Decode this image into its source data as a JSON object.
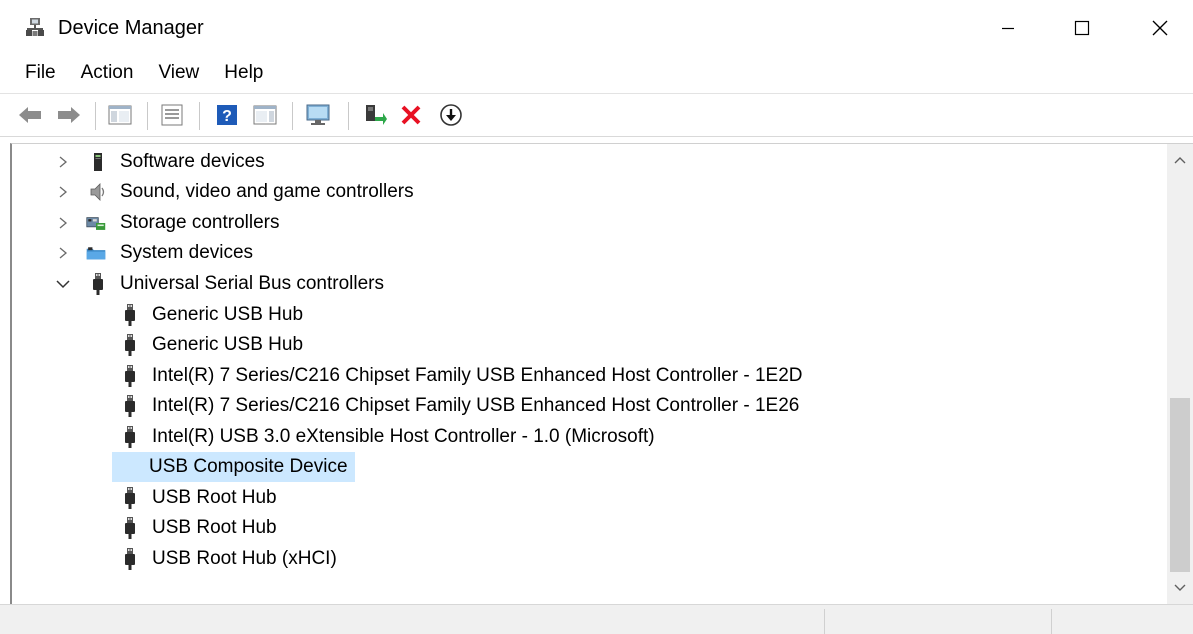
{
  "window": {
    "title": "Device Manager",
    "icon": "device-manager-icon"
  },
  "window_controls": {
    "minimize": "minimize-icon",
    "maximize": "maximize-icon",
    "close": "close-icon"
  },
  "menu": {
    "items": [
      {
        "label": "File"
      },
      {
        "label": "Action"
      },
      {
        "label": "View"
      },
      {
        "label": "Help"
      }
    ]
  },
  "toolbar": {
    "buttons": [
      {
        "icon": "back-arrow-icon"
      },
      {
        "icon": "forward-arrow-icon"
      },
      {
        "icon": "show-hide-console-tree-icon"
      },
      {
        "icon": "properties-icon"
      },
      {
        "icon": "help-icon"
      },
      {
        "icon": "show-hide-action-pane-icon"
      },
      {
        "icon": "scan-hardware-icon"
      },
      {
        "icon": "update-driver-icon"
      },
      {
        "icon": "uninstall-device-icon"
      },
      {
        "icon": "download-arrow-icon"
      }
    ]
  },
  "tree": {
    "categories": [
      {
        "label": "Software devices",
        "icon": "software-device-icon",
        "expanded": false
      },
      {
        "label": "Sound, video and game controllers",
        "icon": "speaker-icon",
        "expanded": false
      },
      {
        "label": "Storage controllers",
        "icon": "storage-controller-icon",
        "expanded": false
      },
      {
        "label": "System devices",
        "icon": "system-folder-icon",
        "expanded": false
      },
      {
        "label": "Universal Serial Bus controllers",
        "icon": "usb-plug-icon",
        "expanded": true
      }
    ],
    "usb_children": [
      {
        "label": "Generic USB Hub"
      },
      {
        "label": "Generic USB Hub"
      },
      {
        "label": "Intel(R) 7 Series/C216 Chipset Family USB Enhanced Host Controller - 1E2D"
      },
      {
        "label": "Intel(R) 7 Series/C216 Chipset Family USB Enhanced Host Controller - 1E26"
      },
      {
        "label": "Intel(R) USB 3.0 eXtensible Host Controller - 1.0 (Microsoft)"
      },
      {
        "label": "USB Composite Device",
        "selected": true
      },
      {
        "label": "USB Root Hub"
      },
      {
        "label": "USB Root Hub"
      },
      {
        "label": "USB Root Hub (xHCI)"
      }
    ]
  },
  "colors": {
    "selection": "#cce8ff",
    "uninstall_red": "#e81123",
    "help_blue": "#1e5bb8"
  }
}
